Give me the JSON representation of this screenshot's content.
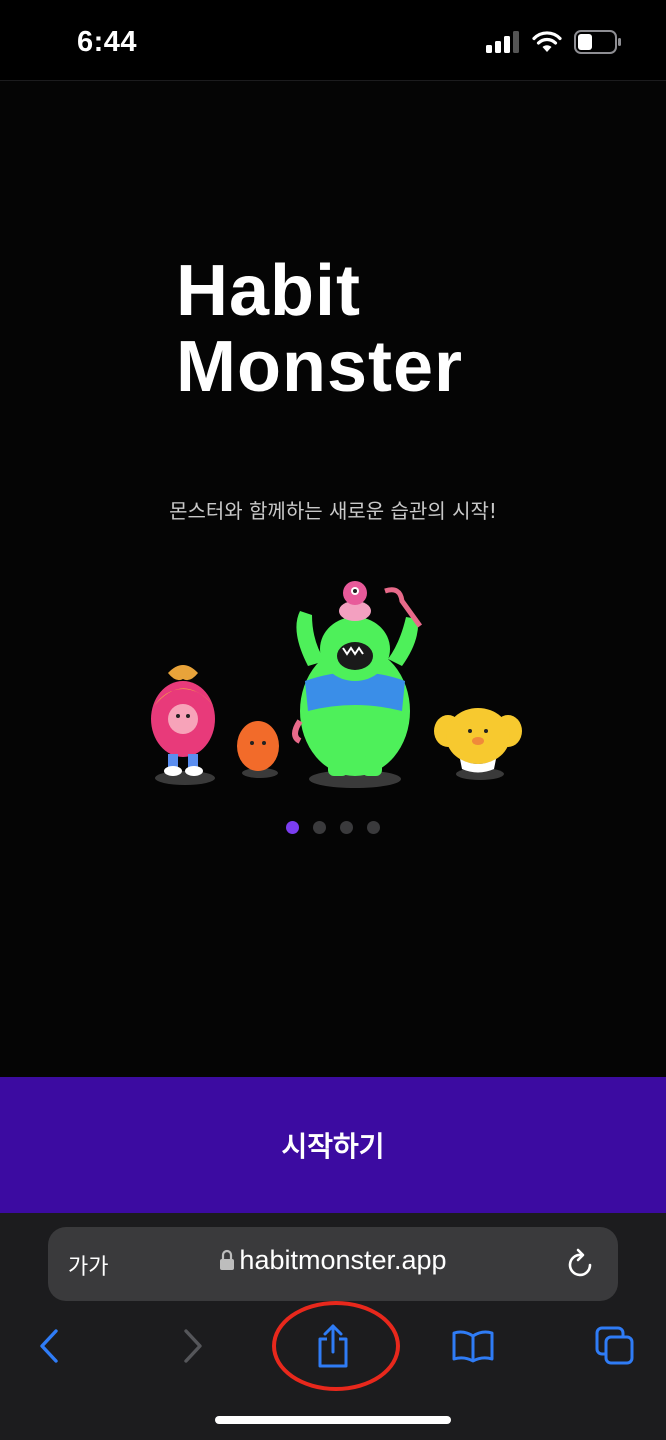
{
  "status_bar": {
    "time": "6:44",
    "signal_icon": "cellular-signal-icon",
    "wifi_icon": "wifi-icon",
    "battery_icon": "battery-icon"
  },
  "hero": {
    "title_line1": "Habit",
    "title_line2": "Monster",
    "subtitle": "몬스터와 함께하는 새로운 습관의 시작!",
    "illustration": "habit-monster-characters-illustration",
    "pager": {
      "total": 4,
      "active_index": 0
    }
  },
  "cta": {
    "label": "시작하기"
  },
  "safari": {
    "aa_label": "가가",
    "url": "habitmonster.app",
    "lock_icon": "lock-icon",
    "reload_icon": "reload-icon",
    "toolbar": [
      "back-icon",
      "forward-icon",
      "share-icon",
      "bookmarks-icon",
      "tabs-icon"
    ]
  },
  "colors": {
    "accent": "#3c0ba1",
    "pager_active": "#7b3df0",
    "link_blue": "#2f7cf6",
    "annotation_red": "#e8281c"
  }
}
